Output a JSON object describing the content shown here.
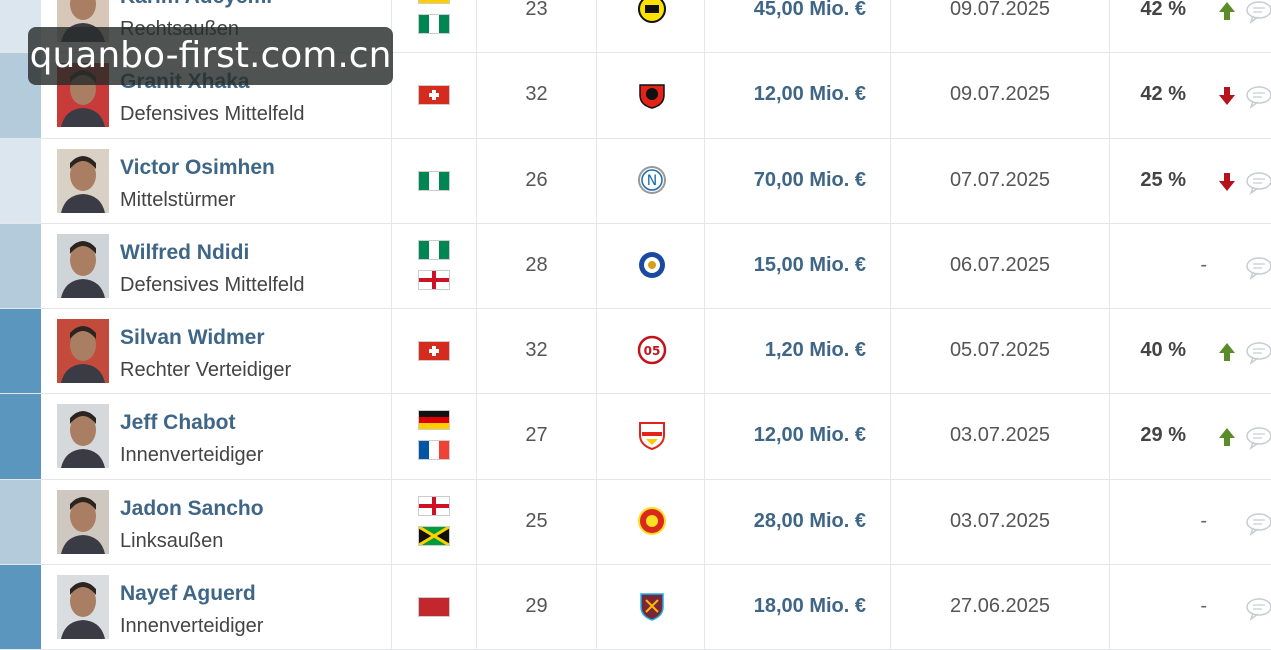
{
  "watermark": "quanbo-first.com.cn",
  "colors": {
    "player_name": "#3f6686",
    "value": "#3f6686",
    "arrow_up": "#5b8c2a",
    "arrow_down": "#b5121b"
  },
  "rows": [
    {
      "name": "Karim Adeyemi",
      "position": "Rechtsaußen",
      "nationalities": [
        "germany-flag",
        "nigeria-flag"
      ],
      "age": "23",
      "club_icon": "borussia-dortmund-crest",
      "value": "45,00 Mio. €",
      "date": "09.07.2025",
      "percent": "42 %",
      "trend": "up",
      "stripe": "#dbe6ee"
    },
    {
      "name": "Granit Xhaka",
      "position": "Defensives Mittelfeld",
      "nationalities": [
        "switzerland-flag"
      ],
      "age": "32",
      "club_icon": "bayer-leverkusen-crest",
      "value": "12,00 Mio. €",
      "date": "09.07.2025",
      "percent": "42 %",
      "trend": "down",
      "stripe": "#b4cbdc"
    },
    {
      "name": "Victor Osimhen",
      "position": "Mittelstürmer",
      "nationalities": [
        "nigeria-flag"
      ],
      "age": "26",
      "club_icon": "ssc-napoli-crest",
      "value": "70,00 Mio. €",
      "date": "07.07.2025",
      "percent": "25 %",
      "trend": "down",
      "stripe": "#dbe6ee"
    },
    {
      "name": "Wilfred Ndidi",
      "position": "Defensives Mittelfeld",
      "nationalities": [
        "nigeria-flag",
        "england-flag"
      ],
      "age": "28",
      "club_icon": "leicester-city-crest",
      "value": "15,00 Mio. €",
      "date": "06.07.2025",
      "percent": "-",
      "trend": "none",
      "stripe": "#b4cbdc"
    },
    {
      "name": "Silvan Widmer",
      "position": "Rechter Verteidiger",
      "nationalities": [
        "switzerland-flag"
      ],
      "age": "32",
      "club_icon": "mainz-05-crest",
      "value": "1,20 Mio. €",
      "date": "05.07.2025",
      "percent": "40 %",
      "trend": "up",
      "stripe": "#5b96be"
    },
    {
      "name": "Jeff Chabot",
      "position": "Innenverteidiger",
      "nationalities": [
        "germany-flag",
        "france-flag"
      ],
      "age": "27",
      "club_icon": "vfb-stuttgart-crest",
      "value": "12,00 Mio. €",
      "date": "03.07.2025",
      "percent": "29 %",
      "trend": "up",
      "stripe": "#5b96be"
    },
    {
      "name": "Jadon Sancho",
      "position": "Linksaußen",
      "nationalities": [
        "england-flag",
        "jamaica-flag"
      ],
      "age": "25",
      "club_icon": "manchester-united-crest",
      "value": "28,00 Mio. €",
      "date": "03.07.2025",
      "percent": "-",
      "trend": "none",
      "stripe": "#b4cbdc"
    },
    {
      "name": "Nayef Aguerd",
      "position": "Innenverteidiger",
      "nationalities": [
        "morocco-flag"
      ],
      "age": "29",
      "club_icon": "west-ham-united-crest",
      "value": "18,00 Mio. €",
      "date": "27.06.2025",
      "percent": "-",
      "trend": "none",
      "stripe": "#5b96be"
    }
  ]
}
